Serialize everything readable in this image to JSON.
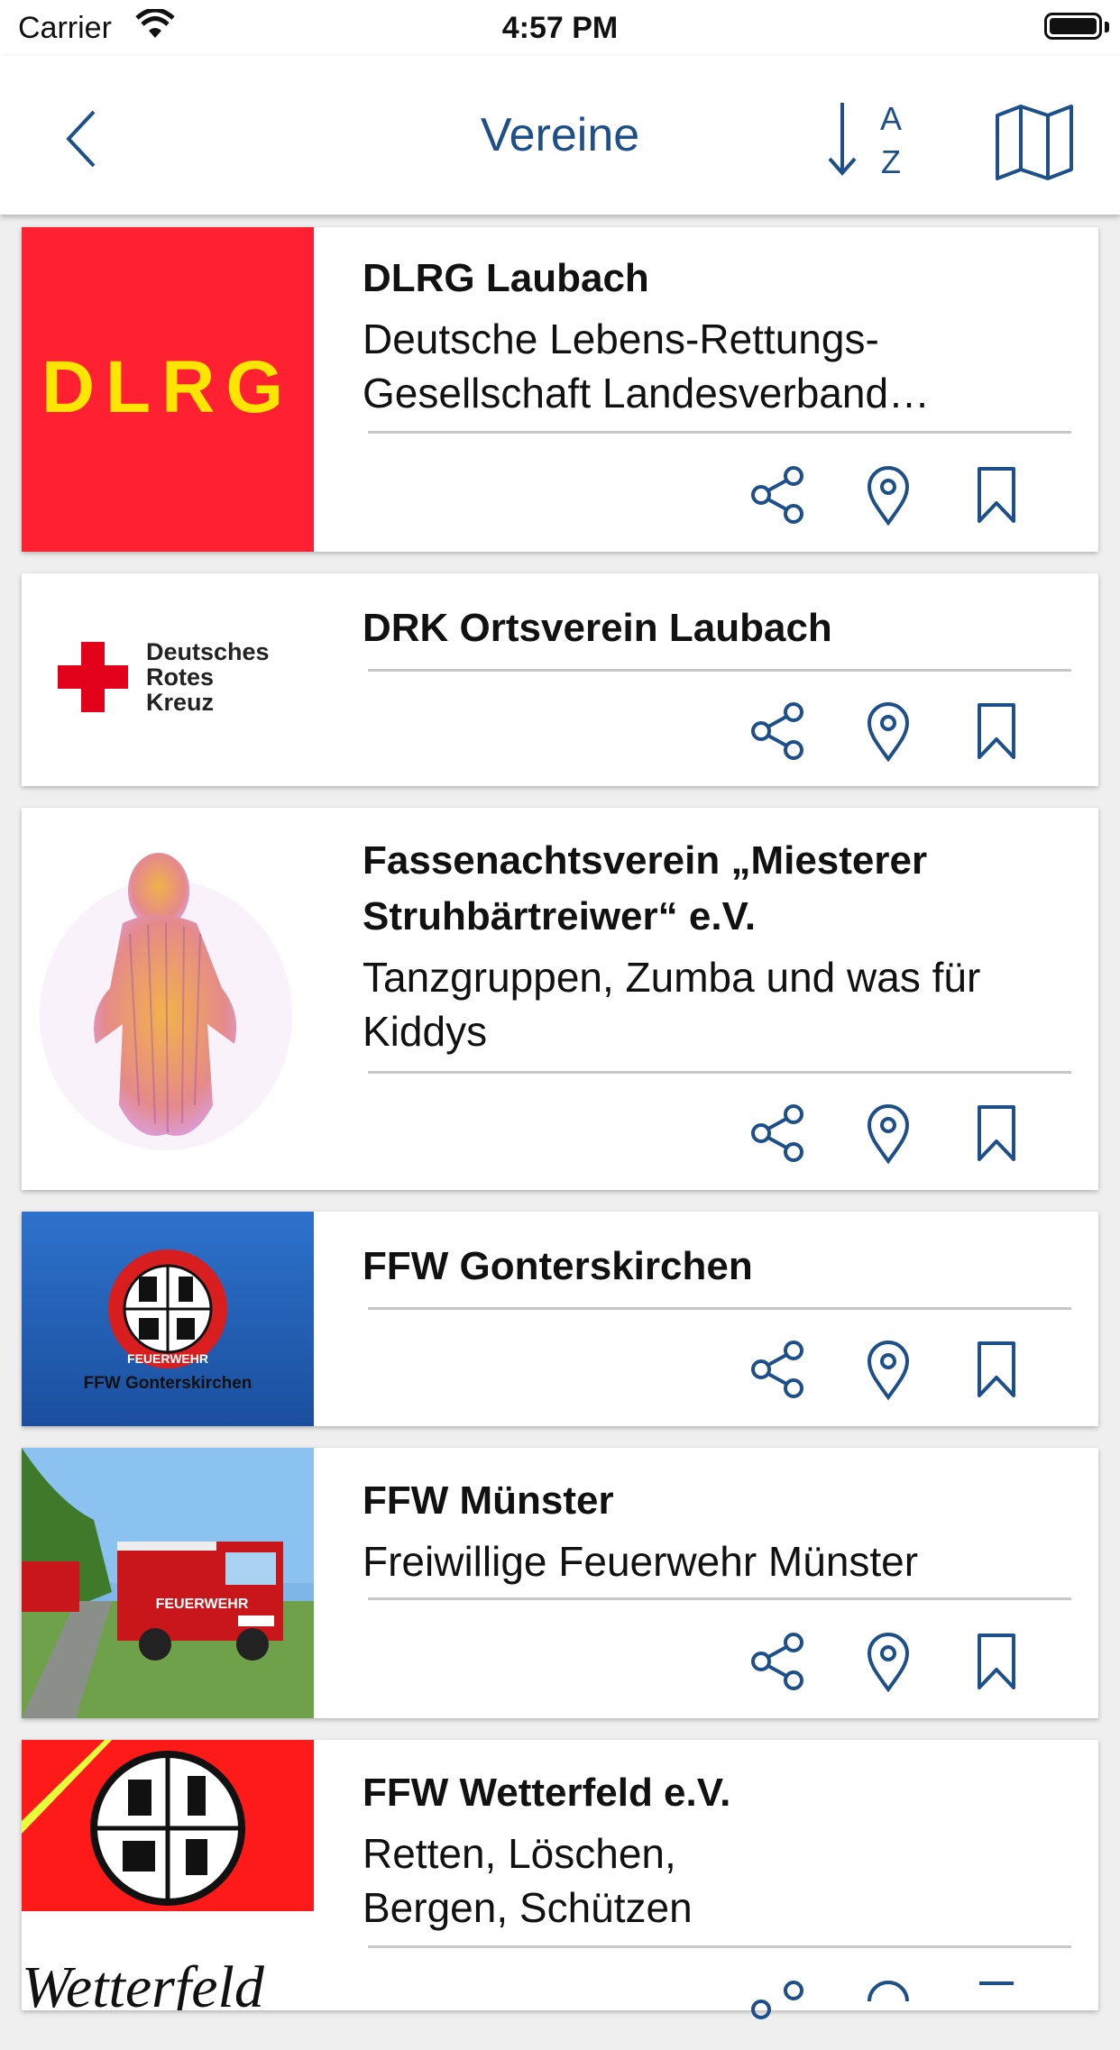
{
  "status_bar": {
    "carrier": "Carrier",
    "time": "4:57 PM"
  },
  "nav": {
    "title": "Vereine",
    "sort_top": "A",
    "sort_bottom": "Z"
  },
  "colors": {
    "accent": "#1d4f8a",
    "dlrg_red": "#ff2032",
    "dlrg_yellow": "#ffe600",
    "drk_red": "#e2001a",
    "ffw_blue": "#1f5fbf"
  },
  "entries": [
    {
      "name": "DLRG Laubach",
      "description": "Deutsche Lebens-Rettungs-Gesellschaft Landesverband…",
      "logo_text": "DLRG"
    },
    {
      "name": "DRK Ortsverein Laubach",
      "description": "",
      "logo_text": [
        "Deutsches",
        "Rotes",
        "Kreuz"
      ]
    },
    {
      "name": "Fassenachtsverein „Miesterer Struhbärtreiwer“ e.V.",
      "description": "Tanzgruppen, Zumba und was für Kiddys"
    },
    {
      "name": "FFW Gonterskirchen",
      "description": "",
      "logo_text": "FFW Gonterskirchen",
      "badge_text": "FEUERWEHR"
    },
    {
      "name": "FFW Münster",
      "description": "Freiwillige Feuerwehr Münster",
      "truck_text": "FEUERWEHR"
    },
    {
      "name": "FFW Wetterfeld e.V.",
      "description": "Retten, Löschen, Bergen, Schützen",
      "logo_text": "Wetterfeld"
    }
  ],
  "icons": [
    "back-chevron-icon",
    "sort-az-icon",
    "map-icon",
    "share-icon",
    "location-pin-icon",
    "bookmark-icon",
    "wifi-icon",
    "battery-icon"
  ]
}
